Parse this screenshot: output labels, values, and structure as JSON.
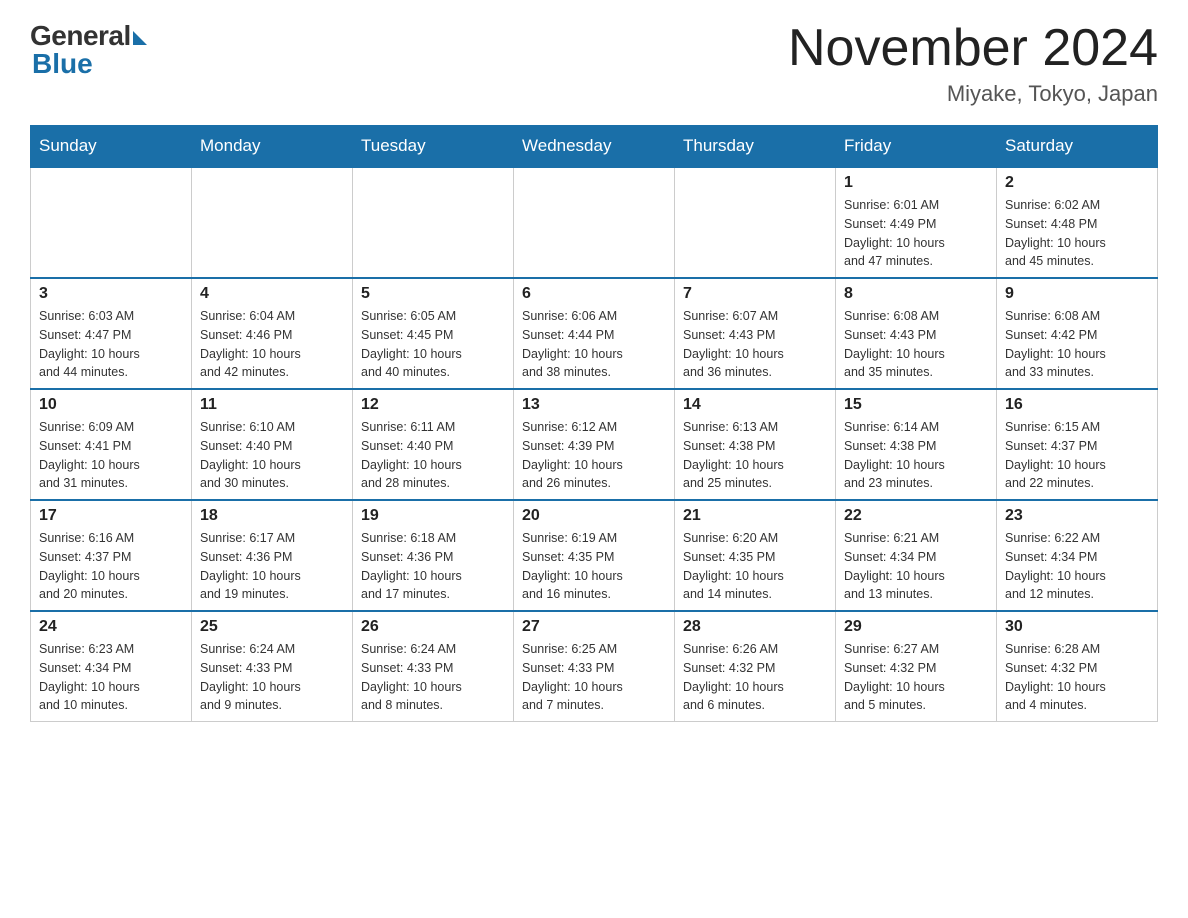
{
  "header": {
    "logo": {
      "general": "General",
      "blue": "Blue"
    },
    "title": "November 2024",
    "location": "Miyake, Tokyo, Japan"
  },
  "weekdays": [
    "Sunday",
    "Monday",
    "Tuesday",
    "Wednesday",
    "Thursday",
    "Friday",
    "Saturday"
  ],
  "weeks": [
    [
      {
        "day": "",
        "info": ""
      },
      {
        "day": "",
        "info": ""
      },
      {
        "day": "",
        "info": ""
      },
      {
        "day": "",
        "info": ""
      },
      {
        "day": "",
        "info": ""
      },
      {
        "day": "1",
        "info": "Sunrise: 6:01 AM\nSunset: 4:49 PM\nDaylight: 10 hours\nand 47 minutes."
      },
      {
        "day": "2",
        "info": "Sunrise: 6:02 AM\nSunset: 4:48 PM\nDaylight: 10 hours\nand 45 minutes."
      }
    ],
    [
      {
        "day": "3",
        "info": "Sunrise: 6:03 AM\nSunset: 4:47 PM\nDaylight: 10 hours\nand 44 minutes."
      },
      {
        "day": "4",
        "info": "Sunrise: 6:04 AM\nSunset: 4:46 PM\nDaylight: 10 hours\nand 42 minutes."
      },
      {
        "day": "5",
        "info": "Sunrise: 6:05 AM\nSunset: 4:45 PM\nDaylight: 10 hours\nand 40 minutes."
      },
      {
        "day": "6",
        "info": "Sunrise: 6:06 AM\nSunset: 4:44 PM\nDaylight: 10 hours\nand 38 minutes."
      },
      {
        "day": "7",
        "info": "Sunrise: 6:07 AM\nSunset: 4:43 PM\nDaylight: 10 hours\nand 36 minutes."
      },
      {
        "day": "8",
        "info": "Sunrise: 6:08 AM\nSunset: 4:43 PM\nDaylight: 10 hours\nand 35 minutes."
      },
      {
        "day": "9",
        "info": "Sunrise: 6:08 AM\nSunset: 4:42 PM\nDaylight: 10 hours\nand 33 minutes."
      }
    ],
    [
      {
        "day": "10",
        "info": "Sunrise: 6:09 AM\nSunset: 4:41 PM\nDaylight: 10 hours\nand 31 minutes."
      },
      {
        "day": "11",
        "info": "Sunrise: 6:10 AM\nSunset: 4:40 PM\nDaylight: 10 hours\nand 30 minutes."
      },
      {
        "day": "12",
        "info": "Sunrise: 6:11 AM\nSunset: 4:40 PM\nDaylight: 10 hours\nand 28 minutes."
      },
      {
        "day": "13",
        "info": "Sunrise: 6:12 AM\nSunset: 4:39 PM\nDaylight: 10 hours\nand 26 minutes."
      },
      {
        "day": "14",
        "info": "Sunrise: 6:13 AM\nSunset: 4:38 PM\nDaylight: 10 hours\nand 25 minutes."
      },
      {
        "day": "15",
        "info": "Sunrise: 6:14 AM\nSunset: 4:38 PM\nDaylight: 10 hours\nand 23 minutes."
      },
      {
        "day": "16",
        "info": "Sunrise: 6:15 AM\nSunset: 4:37 PM\nDaylight: 10 hours\nand 22 minutes."
      }
    ],
    [
      {
        "day": "17",
        "info": "Sunrise: 6:16 AM\nSunset: 4:37 PM\nDaylight: 10 hours\nand 20 minutes."
      },
      {
        "day": "18",
        "info": "Sunrise: 6:17 AM\nSunset: 4:36 PM\nDaylight: 10 hours\nand 19 minutes."
      },
      {
        "day": "19",
        "info": "Sunrise: 6:18 AM\nSunset: 4:36 PM\nDaylight: 10 hours\nand 17 minutes."
      },
      {
        "day": "20",
        "info": "Sunrise: 6:19 AM\nSunset: 4:35 PM\nDaylight: 10 hours\nand 16 minutes."
      },
      {
        "day": "21",
        "info": "Sunrise: 6:20 AM\nSunset: 4:35 PM\nDaylight: 10 hours\nand 14 minutes."
      },
      {
        "day": "22",
        "info": "Sunrise: 6:21 AM\nSunset: 4:34 PM\nDaylight: 10 hours\nand 13 minutes."
      },
      {
        "day": "23",
        "info": "Sunrise: 6:22 AM\nSunset: 4:34 PM\nDaylight: 10 hours\nand 12 minutes."
      }
    ],
    [
      {
        "day": "24",
        "info": "Sunrise: 6:23 AM\nSunset: 4:34 PM\nDaylight: 10 hours\nand 10 minutes."
      },
      {
        "day": "25",
        "info": "Sunrise: 6:24 AM\nSunset: 4:33 PM\nDaylight: 10 hours\nand 9 minutes."
      },
      {
        "day": "26",
        "info": "Sunrise: 6:24 AM\nSunset: 4:33 PM\nDaylight: 10 hours\nand 8 minutes."
      },
      {
        "day": "27",
        "info": "Sunrise: 6:25 AM\nSunset: 4:33 PM\nDaylight: 10 hours\nand 7 minutes."
      },
      {
        "day": "28",
        "info": "Sunrise: 6:26 AM\nSunset: 4:32 PM\nDaylight: 10 hours\nand 6 minutes."
      },
      {
        "day": "29",
        "info": "Sunrise: 6:27 AM\nSunset: 4:32 PM\nDaylight: 10 hours\nand 5 minutes."
      },
      {
        "day": "30",
        "info": "Sunrise: 6:28 AM\nSunset: 4:32 PM\nDaylight: 10 hours\nand 4 minutes."
      }
    ]
  ]
}
